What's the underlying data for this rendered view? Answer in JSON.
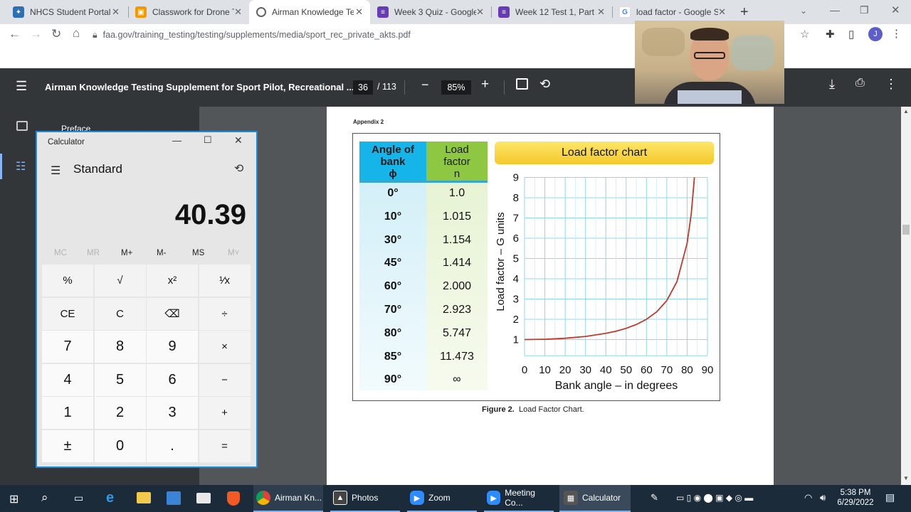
{
  "tabs": [
    {
      "label": "NHCS Student Portal",
      "icon": "student-portal-icon",
      "color": "#2b6fb6"
    },
    {
      "label": "Classwork for Drone T",
      "icon": "classroom-icon",
      "color": "#f29900"
    },
    {
      "label": "Airman Knowledge Te",
      "icon": "pdf-globe-icon",
      "color": "#5f6368"
    },
    {
      "label": "Week 3 Quiz - Google",
      "icon": "forms-icon",
      "color": "#673ab7"
    },
    {
      "label": "Week 12 Test 1, Part 2",
      "icon": "forms-icon",
      "color": "#673ab7"
    },
    {
      "label": "load factor - Google S",
      "icon": "google-icon",
      "color": "#4285f4"
    }
  ],
  "address": {
    "url": "faa.gov/training_testing/testing/supplements/media/sport_rec_private_akts.pdf",
    "profile_initial": "J"
  },
  "pdf": {
    "title": "Airman Knowledge Testing Supplement for Sport Pilot, Recreational ...",
    "page_current": "36",
    "page_total": "/ 113",
    "zoom": "85%",
    "sidebar_label": "Preface",
    "appendix": "Appendix 2",
    "figure_caption_bold": "Figure 2.",
    "figure_caption": "Load Factor Chart."
  },
  "table": {
    "header_angle": [
      "Angle of",
      "bank",
      "ϕ"
    ],
    "header_load": [
      "Load",
      "factor",
      "n"
    ],
    "rows": [
      {
        "angle": "0°",
        "load": "1.0"
      },
      {
        "angle": "10°",
        "load": "1.015"
      },
      {
        "angle": "30°",
        "load": "1.154"
      },
      {
        "angle": "45°",
        "load": "1.414"
      },
      {
        "angle": "60°",
        "load": "2.000"
      },
      {
        "angle": "70°",
        "load": "2.923"
      },
      {
        "angle": "80°",
        "load": "5.747"
      },
      {
        "angle": "85°",
        "load": "11.473"
      },
      {
        "angle": "90°",
        "load": "∞"
      }
    ]
  },
  "chart_data": {
    "type": "line",
    "title": "Load factor chart",
    "xlabel": "Bank angle – in degrees",
    "ylabel": "Load factor – G units",
    "xlim": [
      0,
      90
    ],
    "ylim": [
      0,
      9
    ],
    "x_ticks": [
      "0",
      "10",
      "20",
      "30",
      "40",
      "50",
      "60",
      "70",
      "80",
      "90"
    ],
    "y_ticks": [
      "1",
      "2",
      "3",
      "4",
      "5",
      "6",
      "7",
      "8",
      "9"
    ],
    "grid": true,
    "series": [
      {
        "x": [
          0,
          10,
          20,
          30,
          40,
          45,
          50,
          55,
          60,
          65,
          70,
          75,
          80,
          82,
          83.6
        ],
        "y": [
          1.0,
          1.015,
          1.064,
          1.154,
          1.305,
          1.414,
          1.556,
          1.743,
          2.0,
          2.366,
          2.923,
          3.864,
          5.747,
          7.19,
          9.0
        ]
      }
    ],
    "colors": {
      "line": "#c0392b",
      "grid": "#8fd8e8"
    }
  },
  "calculator": {
    "title": "Calculator",
    "mode": "Standard",
    "display": "40.39",
    "memory": [
      "MC",
      "MR",
      "M+",
      "M-",
      "MS",
      "M˅"
    ],
    "keys": [
      [
        "%",
        "√",
        "x²",
        "¹⁄x"
      ],
      [
        "CE",
        "C",
        "⌫",
        "÷"
      ],
      [
        "7",
        "8",
        "9",
        "×"
      ],
      [
        "4",
        "5",
        "6",
        "−"
      ],
      [
        "1",
        "2",
        "3",
        "+"
      ],
      [
        "±",
        "0",
        ".",
        "="
      ]
    ]
  },
  "taskbar": {
    "apps": [
      "Airman Kn...",
      "Photos",
      "Zoom",
      "Meeting Co...",
      "Calculator"
    ],
    "time": "5:38 PM",
    "date": "6/29/2022"
  }
}
